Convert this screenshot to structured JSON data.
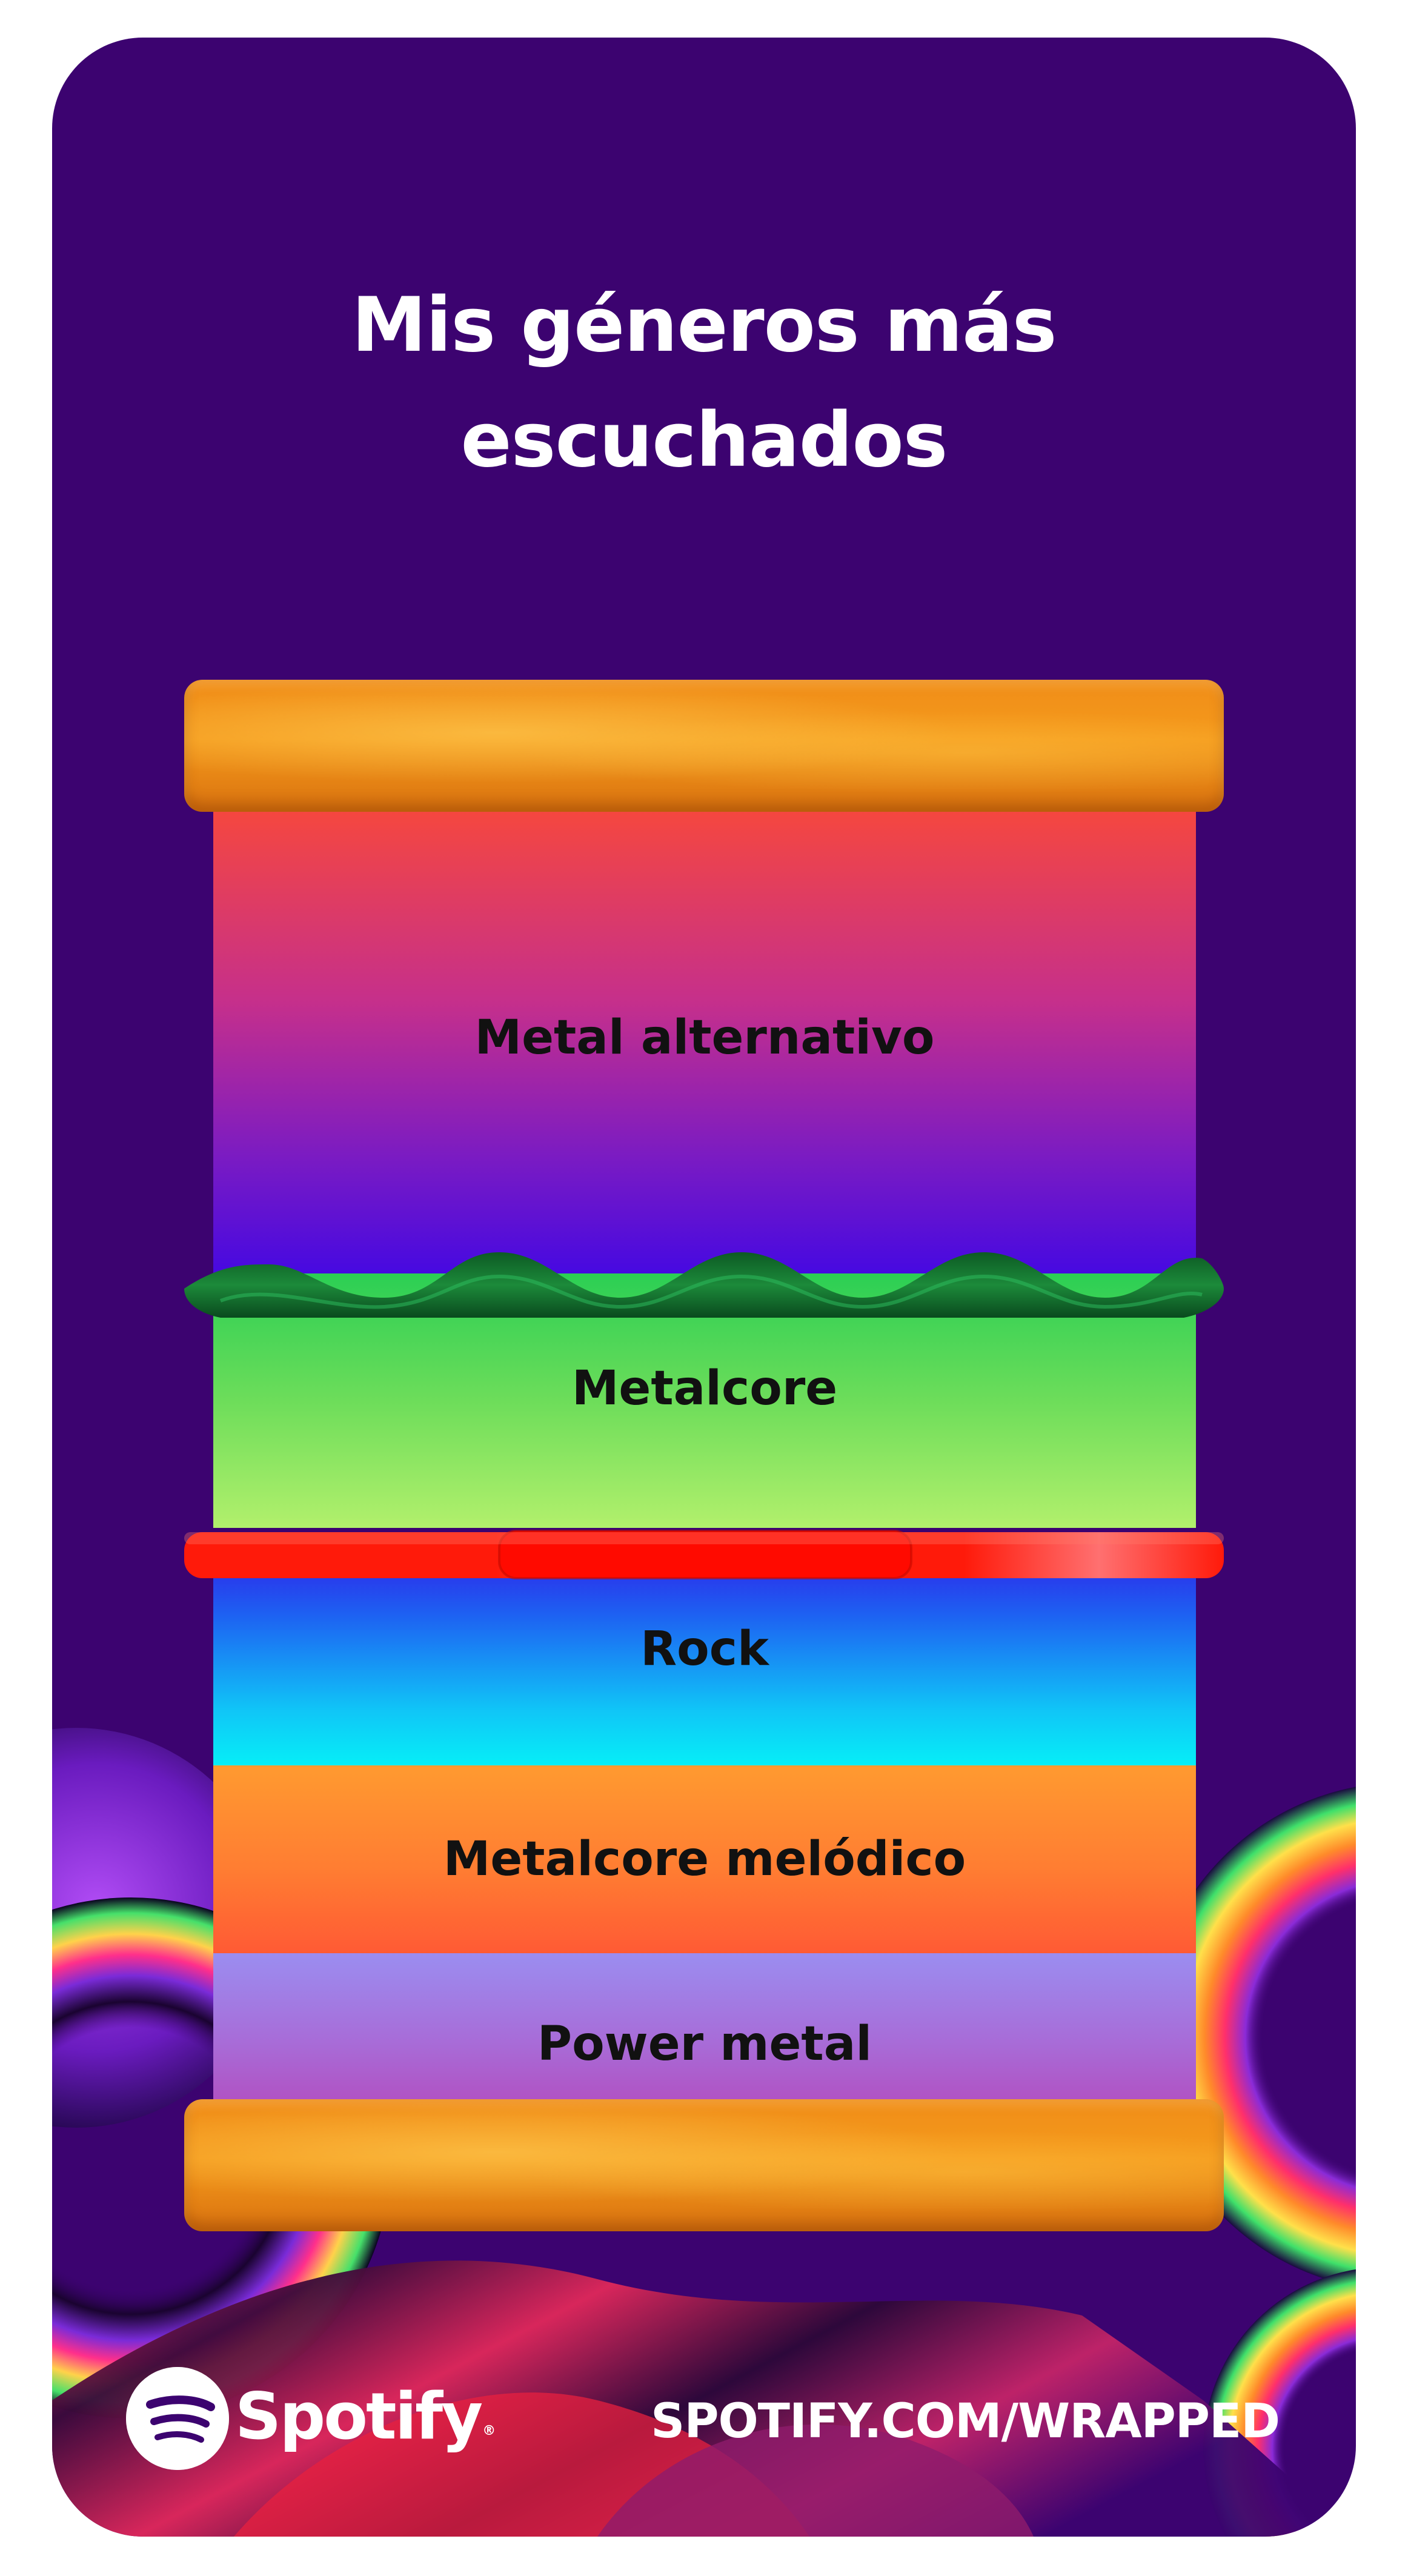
{
  "title": {
    "line1": "Mis géneros más",
    "line2": "escuchados"
  },
  "genres": [
    {
      "label": "Metal alternativo"
    },
    {
      "label": "Metalcore"
    },
    {
      "label": "Rock"
    },
    {
      "label": "Metalcore melódico"
    },
    {
      "label": "Power metal"
    }
  ],
  "footer": {
    "brand": "Spotify",
    "trademark": "®",
    "url": "SPOTIFY.COM/WRAPPED"
  },
  "colors": {
    "background": "#3c0370",
    "bun": "#f08d18",
    "lettuce": "#0e6b2a",
    "tomato": "#ff1a0a",
    "text_light": "#ffffff",
    "text_dark": "#111111"
  },
  "icons": {
    "logo": "spotify-logo-icon"
  }
}
